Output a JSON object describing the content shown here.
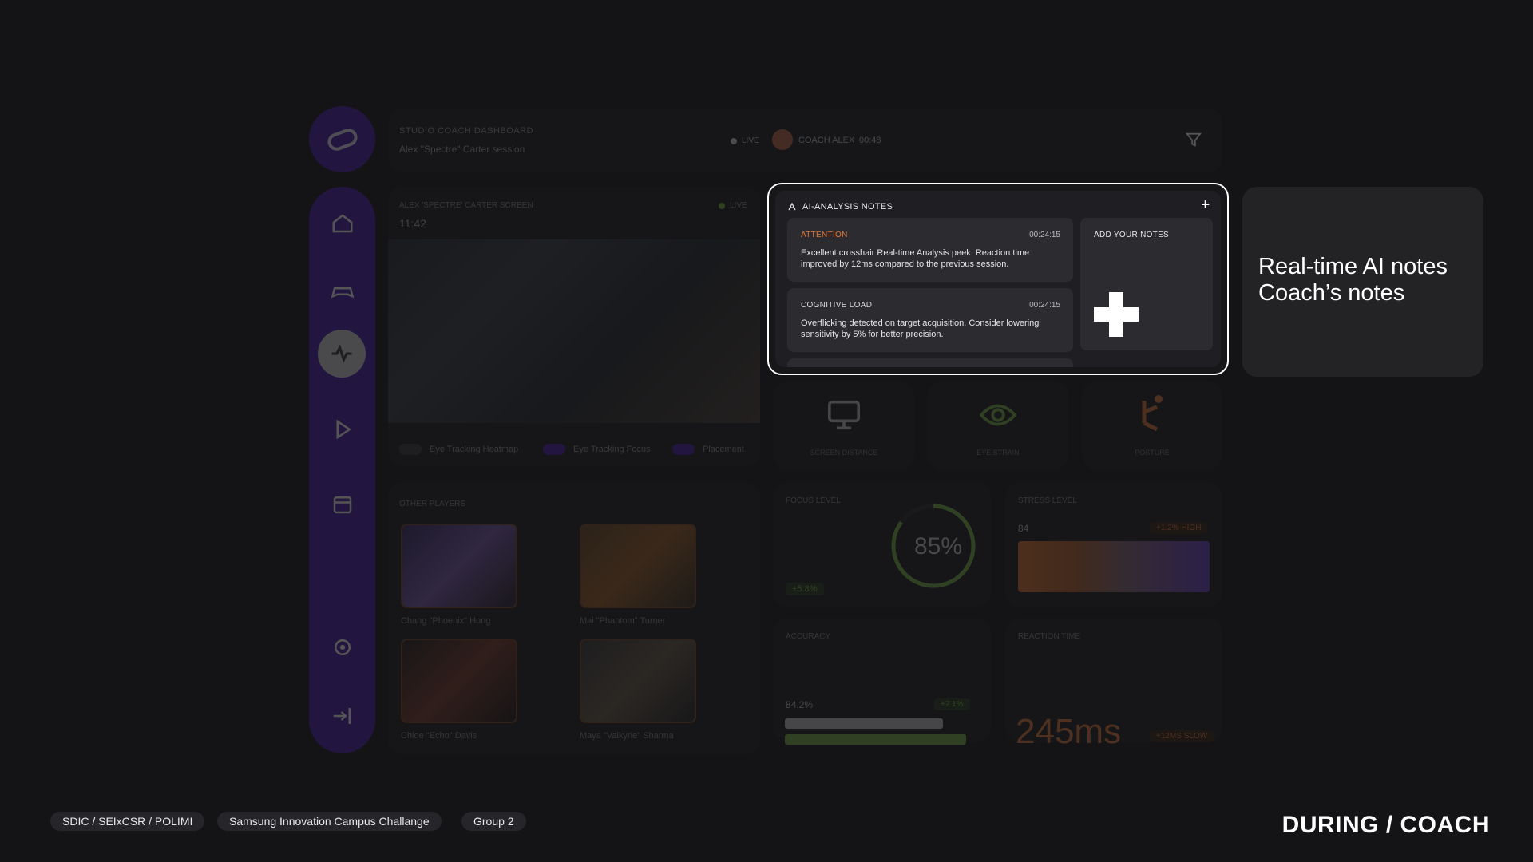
{
  "header": {
    "title": "STUDIO COACH DASHBOARD",
    "subtitle": "Alex \"Spectre\" Carter session",
    "live": "LIVE",
    "coach": "COACH ALEX",
    "time": "00:48"
  },
  "video": {
    "title": "ALEX 'SPECTRE' CARTER SCREEN",
    "timer": "11:42",
    "live": "LIVE",
    "toggles": [
      {
        "label": "Eye Tracking Heatmap",
        "on": false
      },
      {
        "label": "Eye Tracking Focus",
        "on": true
      },
      {
        "label": "Placement",
        "on": true
      }
    ]
  },
  "metrics": [
    {
      "label": "SCREEN DISTANCE",
      "icon": "monitor-icon"
    },
    {
      "label": "EYE STRAIN",
      "icon": "eye-icon"
    },
    {
      "label": "POSTURE",
      "icon": "posture-icon"
    }
  ],
  "players": {
    "title": "OTHER PLAYERS",
    "items": [
      {
        "name": "Chang \"Phoenix\" Hong"
      },
      {
        "name": "Mai \"Phantom\" Turner"
      },
      {
        "name": "Chloe \"Echo\" Davis"
      },
      {
        "name": "Maya \"Valkyrie\" Sharma"
      }
    ]
  },
  "stats": {
    "focus_title": "FOCUS LEVEL",
    "focus_value": "85%",
    "focus_badge": "+5.8%",
    "stress_title": "STRESS LEVEL",
    "stress_value": "84",
    "stress_badge": "+1.2% HIGH",
    "accuracy_title": "ACCURACY",
    "accuracy_value": "84.2%",
    "accuracy_badge": "+2.1%",
    "reaction_title": "REACTION TIME",
    "reaction_value": "245ms",
    "reaction_badge": "+12MS SLOW"
  },
  "notes": {
    "title": "AI-ANALYSIS NOTES",
    "add_symbol": "+",
    "items": [
      {
        "tag": "ATTENTION",
        "time": "00:24:15",
        "text": "Excellent crosshair Real-time Analysis peek. Reaction time improved by 12ms compared to the previous session.",
        "color": "#e0783a"
      },
      {
        "tag": "COGNITIVE LOAD",
        "time": "00:24:15",
        "text": "Overflicking detected on target acquisition. Consider lowering sensitivity by 5% for better precision.",
        "color": "#d8d8dc"
      }
    ],
    "add_label": "ADD YOUR NOTES"
  },
  "callout": {
    "line1": "Real-time AI notes",
    "line2": "Coach’s notes"
  },
  "footer": {
    "tags": [
      "SDIC / SEIxCSR / POLIMI",
      "Samsung Innovation Campus Challange",
      "Group 2"
    ],
    "title": "DURING / COACH"
  },
  "colors": {
    "accent": "#4a1fb3",
    "attention": "#e0783a",
    "background": "#141416"
  }
}
